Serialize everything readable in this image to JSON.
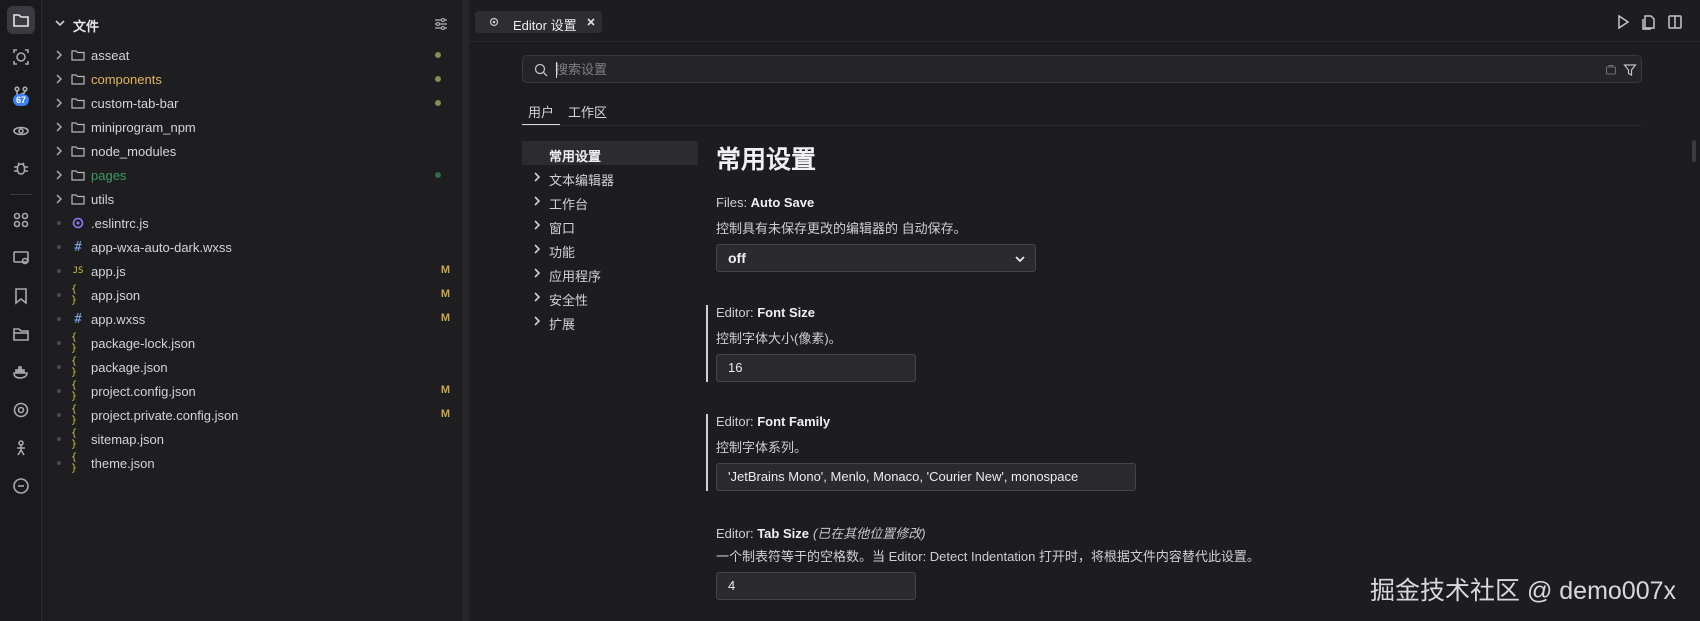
{
  "activity": {
    "badge": "67",
    "icons": [
      "files-icon",
      "search-icon",
      "source-control-icon",
      "debug-icon",
      "bug-icon",
      "extensions-icon",
      "remote-icon",
      "bookmark-icon",
      "folder-icon",
      "docker-icon",
      "network-icon",
      "puppet-icon",
      "json-icon"
    ]
  },
  "explorer": {
    "title": "文件",
    "items": [
      {
        "name": "asseat",
        "kind": "folder",
        "dot": "#8a8a55"
      },
      {
        "name": "components",
        "kind": "folder",
        "color": "yellow",
        "dot": "#8a8a55"
      },
      {
        "name": "custom-tab-bar",
        "kind": "folder",
        "dot": "#8a8a55"
      },
      {
        "name": "miniprogram_npm",
        "kind": "folder"
      },
      {
        "name": "node_modules",
        "kind": "folder"
      },
      {
        "name": "pages",
        "kind": "folder",
        "color": "green",
        "dot": "#2e6b48"
      },
      {
        "name": "utils",
        "kind": "folder"
      },
      {
        "name": ".eslintrc.js",
        "kind": "eslint"
      },
      {
        "name": "app-wxa-auto-dark.wxss",
        "kind": "hash"
      },
      {
        "name": "app.js",
        "kind": "js",
        "status": "M"
      },
      {
        "name": "app.json",
        "kind": "json",
        "status": "M"
      },
      {
        "name": "app.wxss",
        "kind": "hash",
        "status": "M"
      },
      {
        "name": "package-lock.json",
        "kind": "json"
      },
      {
        "name": "package.json",
        "kind": "json"
      },
      {
        "name": "project.config.json",
        "kind": "json",
        "status": "M"
      },
      {
        "name": "project.private.config.json",
        "kind": "json",
        "status": "M"
      },
      {
        "name": "sitemap.json",
        "kind": "json"
      },
      {
        "name": "theme.json",
        "kind": "json"
      }
    ],
    "icon_glyphs": {
      "js": "JS",
      "json": "{ }",
      "hash": "#"
    }
  },
  "tab": {
    "label": "Editor 设置"
  },
  "search": {
    "placeholder": "搜索设置"
  },
  "scope_tabs": [
    "用户",
    "工作区"
  ],
  "toc": [
    {
      "label": "常用设置",
      "active": true
    },
    {
      "label": "文本编辑器"
    },
    {
      "label": "工作台"
    },
    {
      "label": "窗口"
    },
    {
      "label": "功能"
    },
    {
      "label": "应用程序"
    },
    {
      "label": "安全性"
    },
    {
      "label": "扩展"
    }
  ],
  "section_title": "常用设置",
  "settings": {
    "auto_save": {
      "prefix": "Files: ",
      "name": "Auto Save",
      "desc": "控制具有未保存更改的编辑器的 自动保存。",
      "value": "off"
    },
    "font_size": {
      "prefix": "Editor: ",
      "name": "Font Size",
      "desc": "控制字体大小(像素)。",
      "value": "16"
    },
    "font_family": {
      "prefix": "Editor: ",
      "name": "Font Family",
      "desc": "控制字体系列。",
      "value": "'JetBrains Mono', Menlo, Monaco, 'Courier New', monospace"
    },
    "tab_size": {
      "prefix": "Editor: ",
      "name": "Tab Size",
      "note": "(已在其他位置修改)",
      "desc": "一个制表符等于的空格数。当 Editor: Detect Indentation 打开时，将根据文件内容替代此设置。",
      "value": "4"
    }
  },
  "watermark": "掘金技术社区 @ demo007x"
}
